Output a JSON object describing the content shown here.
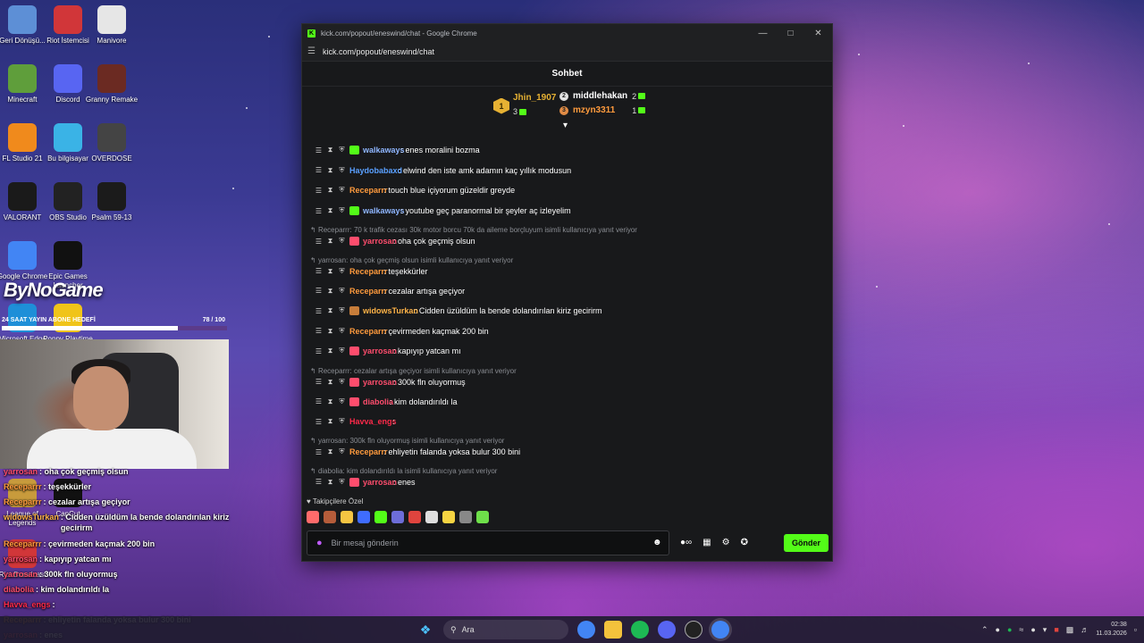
{
  "desktop": {
    "icons": [
      {
        "label": "Geri Dönüşü...",
        "icon": "recycle-bin-icon",
        "color": "#5d8fd6"
      },
      {
        "label": "Riot İstemcisi",
        "icon": "riot-client-icon",
        "color": "#d13639"
      },
      {
        "label": "Manivore",
        "icon": "manivore-icon",
        "color": "#e6e6e6"
      },
      {
        "label": "Minecraft",
        "icon": "minecraft-icon",
        "color": "#5f9e3b"
      },
      {
        "label": "Discord",
        "icon": "discord-icon",
        "color": "#5865f2"
      },
      {
        "label": "Granny Remake",
        "icon": "granny-icon",
        "color": "#6b2a22"
      },
      {
        "label": "FL Studio 21",
        "icon": "fl-studio-icon",
        "color": "#f08a1c"
      },
      {
        "label": "Bu bilgisayar",
        "icon": "this-pc-icon",
        "color": "#3ab3e6"
      },
      {
        "label": "OVERDOSE",
        "icon": "overdose-icon",
        "color": "#444444"
      },
      {
        "label": "VALORANT",
        "icon": "valorant-icon",
        "color": "#1a1a1a"
      },
      {
        "label": "OBS Studio",
        "icon": "obs-icon",
        "color": "#222222"
      },
      {
        "label": "Psalm 59-13",
        "icon": "psalm-icon",
        "color": "#1b1b1b"
      },
      {
        "label": "Google Chrome",
        "icon": "chrome-icon",
        "color": "#4285f4"
      },
      {
        "label": "Epic Games Launcher",
        "icon": "epic-games-icon",
        "color": "#111111"
      },
      {
        "label": "Microsoft Edge",
        "icon": "edge-icon",
        "color": "#1e8fd8"
      },
      {
        "label": "Poppy Playtime",
        "icon": "poppy-icon",
        "color": "#f0c419"
      },
      {
        "label": "League of Legends",
        "icon": "league-icon",
        "color": "#c89b3c"
      },
      {
        "label": "CapCut",
        "icon": "capcut-icon",
        "color": "#111111"
      },
      {
        "label": "Riot Broadcast",
        "icon": "broadcast-icon",
        "color": "#d13639"
      }
    ]
  },
  "overlay": {
    "logo": "ByNoGame",
    "goal_label": "24 SAAT YAYIN ABONE HEDEFİ",
    "goal_value": "78 / 100",
    "goal_fraction": 0.78,
    "chat": [
      {
        "user": "yarrosan",
        "text": " : oha çok geçmiş olsun",
        "color": "#ff4d6d"
      },
      {
        "user": "Receparrr",
        "text": " : teşekkürler",
        "color": "#ff9b3d"
      },
      {
        "user": "Receparrr",
        "text": " : cezalar artışa geçiyor",
        "color": "#ff9b3d"
      },
      {
        "user": "widowsTurkan",
        "text": " : Cidden üzüldüm la bende dolandırılan kiriz gecirirm",
        "color": "#ffb347"
      },
      {
        "user": "Receparrr",
        "text": " : çevirmeden kaçmak 200 bin",
        "color": "#ff9b3d"
      },
      {
        "user": "yarrosan",
        "text": " : kapıyıp yatcan mı",
        "color": "#ff4d6d"
      },
      {
        "user": "yarrosan",
        "text": " : 300k fln oluyormuş",
        "color": "#ff4d6d"
      },
      {
        "user": "diabolia",
        "text": " : kim dolandırıldı la",
        "color": "#ff4d6d"
      },
      {
        "user": "Havva_engs",
        "text": " :",
        "color": "#ff2a4a"
      },
      {
        "user": "Receparrr",
        "text": " : ehliyetin falanda yoksa bulur 300 bini",
        "color": "#ff9b3d"
      },
      {
        "user": "yarrosan",
        "text": " : enes",
        "color": "#ff4d6d"
      }
    ]
  },
  "browser": {
    "title": "kick.com/popout/eneswind/chat - Google Chrome",
    "url": "kick.com/popout/eneswind/chat",
    "chat_title": "Sohbet",
    "leaderboard": {
      "first": {
        "rank": "1",
        "name": "Jhin_1907",
        "count": "3",
        "color": "#e6b133"
      },
      "second": {
        "name": "middlehakan",
        "count": "2",
        "color": "#ffffff"
      },
      "third": {
        "name": "mzyn3311",
        "count": "1",
        "color": "#ff9b3d"
      }
    },
    "messages": [
      {
        "reply": "",
        "user": "walkaways",
        "text": ": enes moralini bozma",
        "color": "#8fb6ff",
        "badge": "#53fc18"
      },
      {
        "reply": "",
        "user": "Haydobabaxd",
        "text": ": elwind den iste amk adamın kaç yıllık modusun",
        "color": "#5aa0ff",
        "badge": ""
      },
      {
        "reply": "",
        "user": "Receparrr",
        "text": ": touch blue içiyorum güzeldir greyde",
        "color": "#ff9b3d",
        "badge": ""
      },
      {
        "reply": "",
        "user": "walkaways",
        "text": ": youtube geç paranormal bir şeyler aç izleyelim",
        "color": "#8fb6ff",
        "badge": "#53fc18"
      },
      {
        "reply": "Receparrr: 70 k trafik cezası 30k motor borcu 70k da aileme borçluyum isimli kullanıcıya yanıt veriyor",
        "user": "yarrosan",
        "text": ": oha çok geçmiş olsun",
        "color": "#ff4d6d",
        "badge": "#ff4d6d"
      },
      {
        "reply": "yarrosan: oha çok geçmiş olsun isimli kullanıcıya yanıt veriyor",
        "user": "Receparrr",
        "text": ": teşekkürler",
        "color": "#ff9b3d",
        "badge": ""
      },
      {
        "reply": "",
        "user": "Receparrr",
        "text": ": cezalar artışa geçiyor",
        "color": "#ff9b3d",
        "badge": ""
      },
      {
        "reply": "",
        "user": "widowsTurkan",
        "text": ": Cidden üzüldüm la bende dolandırılan kiriz gecirirm",
        "color": "#ffb347",
        "badge": "#c77d3a"
      },
      {
        "reply": "",
        "user": "Receparrr",
        "text": ": çevirmeden kaçmak 200 bin",
        "color": "#ff9b3d",
        "badge": ""
      },
      {
        "reply": "",
        "user": "yarrosan",
        "text": ": kapıyıp yatcan mı",
        "color": "#ff4d6d",
        "badge": "#ff4d6d"
      },
      {
        "reply": "Receparrr: cezalar artışa geçiyor isimli kullanıcıya yanıt veriyor",
        "user": "yarrosan",
        "text": ": 300k fln oluyormuş",
        "color": "#ff4d6d",
        "badge": "#ff4d6d"
      },
      {
        "reply": "",
        "user": "diabolia",
        "text": ": kim dolandırıldı la",
        "color": "#ff4d6d",
        "badge": "#ff4d6d"
      },
      {
        "reply": "",
        "user": "Havva_engs",
        "text": ":",
        "color": "#ff2a4a",
        "badge": ""
      },
      {
        "reply": "yarrosan: 300k fln oluyormuş isimli kullanıcıya yanıt veriyor",
        "user": "Receparrr",
        "text": ": ehliyetin falanda yoksa bulur 300 bini",
        "color": "#ff9b3d",
        "badge": ""
      },
      {
        "reply": "diabolia: kim dolandırıldı la isimli kullanıcıya yanıt veriyor",
        "user": "yarrosan",
        "text": ": enes",
        "color": "#ff4d6d",
        "badge": "#ff4d6d"
      }
    ],
    "followers_label": "Takipçilere Özel",
    "input_placeholder": "Bir mesaj gönderin",
    "send_label": "Gönder"
  },
  "taskbar": {
    "search_placeholder": "Ara",
    "time": "02:38",
    "date": "11.03.2026"
  },
  "colors": {
    "kick_green": "#53fc18",
    "chat_bg": "#18191b"
  }
}
